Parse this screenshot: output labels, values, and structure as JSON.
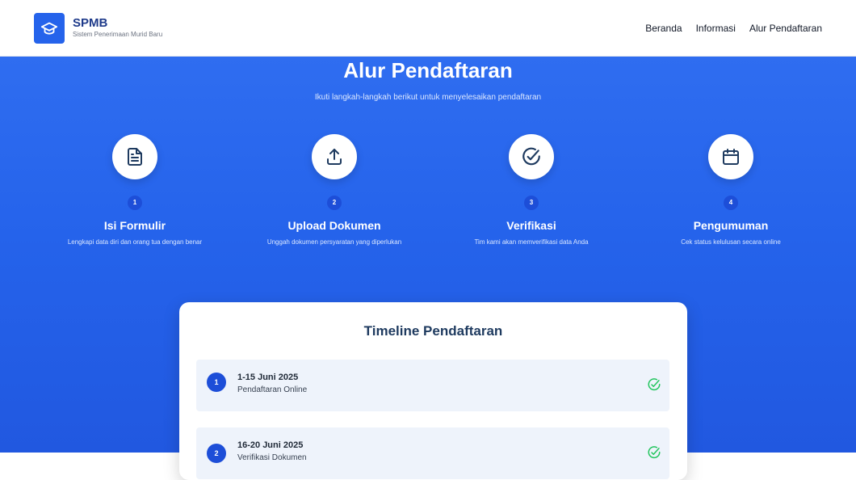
{
  "brand": {
    "name": "SPMB",
    "subtitle": "Sistem Penerimaan Murid Baru",
    "icon": "graduation-cap-icon"
  },
  "nav": {
    "items": [
      {
        "label": "Beranda"
      },
      {
        "label": "Informasi"
      },
      {
        "label": "Alur Pendaftaran"
      }
    ]
  },
  "hero": {
    "title": "Alur Pendaftaran",
    "subtitle": "Ikuti langkah-langkah berikut untuk menyelesaikan pendaftaran"
  },
  "steps": [
    {
      "number": "1",
      "title": "Isi Formulir",
      "desc": "Lengkapi data diri dan orang tua dengan benar",
      "icon": "document-icon"
    },
    {
      "number": "2",
      "title": "Upload Dokumen",
      "desc": "Unggah dokumen persyaratan yang diperlukan",
      "icon": "upload-icon"
    },
    {
      "number": "3",
      "title": "Verifikasi",
      "desc": "Tim kami akan memverifikasi data Anda",
      "icon": "check-circle-icon"
    },
    {
      "number": "4",
      "title": "Pengumuman",
      "desc": "Cek status kelulusan secara online",
      "icon": "calendar-icon"
    }
  ],
  "timeline": {
    "title": "Timeline Pendaftaran",
    "items": [
      {
        "number": "1",
        "date": "1-15 Juni 2025",
        "label": "Pendaftaran Online"
      },
      {
        "number": "2",
        "date": "16-20 Juni 2025",
        "label": "Verifikasi Dokumen"
      }
    ]
  },
  "colors": {
    "primary": "#2563eb",
    "navy": "#1e3a8a",
    "success": "#22c55e"
  }
}
